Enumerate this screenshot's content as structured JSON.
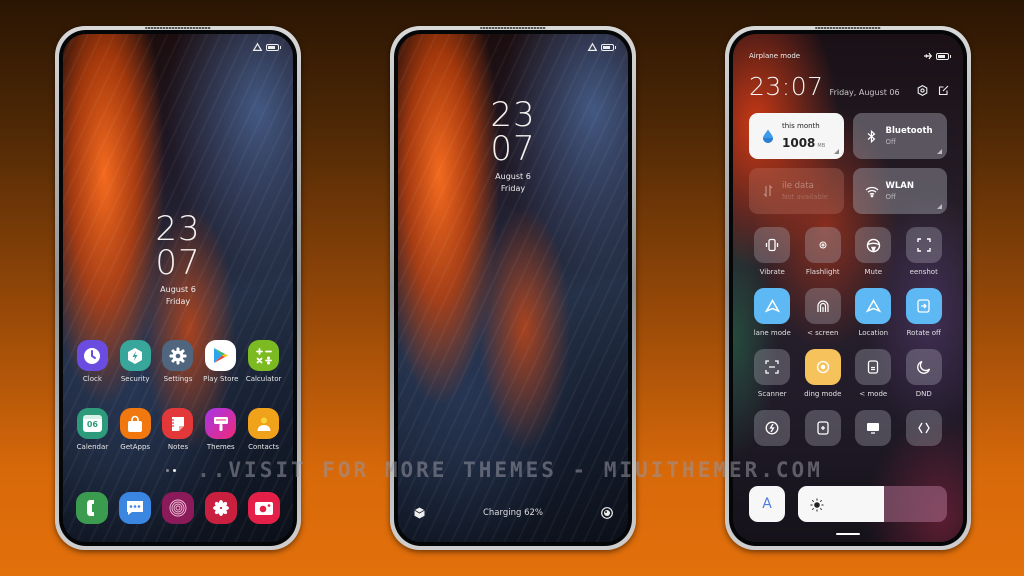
{
  "watermark": "..VISIT FOR MORE THEMES - MIUITHEMER.COM",
  "home_screen": {
    "clock": {
      "hours": "23",
      "minutes": "07",
      "date": "August 6",
      "day": "Friday"
    },
    "battery_percent": 60,
    "apps_row1": [
      {
        "label": "Clock",
        "icon": "clock-icon",
        "color": "#6a4de0"
      },
      {
        "label": "Security",
        "icon": "security-bolt-icon",
        "color": "#38a69a"
      },
      {
        "label": "Settings",
        "icon": "gear-icon",
        "color": "#50667e"
      },
      {
        "label": "Play Store",
        "icon": "play-store-icon",
        "color": "#ffffff"
      },
      {
        "label": "Calculator",
        "icon": "calculator-icon",
        "color": "#7cba22"
      }
    ],
    "apps_row2": [
      {
        "label": "Calendar",
        "icon": "calendar-icon",
        "color": "#2e9a7c",
        "glyph": "06"
      },
      {
        "label": "GetApps",
        "icon": "shopping-bag-icon",
        "color": "#f0780e"
      },
      {
        "label": "Notes",
        "icon": "notes-icon",
        "color": "#e2383a"
      },
      {
        "label": "Themes",
        "icon": "themes-brush-icon",
        "color": "#d8288a"
      },
      {
        "label": "Contacts",
        "icon": "contacts-icon",
        "color": "#f0a21a"
      }
    ],
    "dock": [
      {
        "name": "phone",
        "icon": "phone-icon",
        "color": "#3b9c4f"
      },
      {
        "name": "messages",
        "icon": "messages-icon",
        "color": "#3b86e0"
      },
      {
        "name": "fingerprint",
        "icon": "fingerprint-icon",
        "color": "#8a1a5a"
      },
      {
        "name": "gallery",
        "icon": "gallery-flower-icon",
        "color": "#c8203e"
      },
      {
        "name": "camera",
        "icon": "camera-icon",
        "color": "#e52048"
      }
    ]
  },
  "lock_screen": {
    "clock": {
      "hours": "23",
      "minutes": "07",
      "date": "August 6",
      "day": "Friday"
    },
    "charging_text": "Charging 62%",
    "battery_percent": 62
  },
  "control_center": {
    "status_label": "Airplane mode",
    "time": "23:07",
    "date": "Friday, August 06",
    "data_usage": {
      "label": "this month",
      "value": "1008",
      "unit": "MB"
    },
    "bluetooth": {
      "label": "Bluetooth",
      "state": "Off"
    },
    "mobile_data": {
      "label": "ile data",
      "state": "Not available"
    },
    "wlan": {
      "label": "WLAN",
      "state": "Off"
    },
    "toggles": [
      {
        "label": "Vibrate",
        "icon": "vibrate-icon",
        "active": false
      },
      {
        "label": "Flashlight",
        "icon": "flashlight-icon",
        "active": false
      },
      {
        "label": "Mute",
        "icon": "mute-icon",
        "active": false
      },
      {
        "label": "eenshot",
        "icon": "screenshot-icon",
        "active": false
      },
      {
        "label": "lane mode",
        "icon": "airplane-mode-icon",
        "active": true
      },
      {
        "label": "< screen",
        "icon": "lock-screen-icon",
        "active": false
      },
      {
        "label": "Location",
        "icon": "location-icon",
        "active": true
      },
      {
        "label": "Rotate off",
        "icon": "rotate-icon",
        "active": true
      },
      {
        "label": "Scanner",
        "icon": "scanner-icon",
        "active": false
      },
      {
        "label": "ding mode",
        "icon": "reading-mode-icon",
        "active": true
      },
      {
        "label": "< mode",
        "icon": "dark-mode-icon",
        "active": false
      },
      {
        "label": "DND",
        "icon": "dnd-moon-icon",
        "active": false
      },
      {
        "label": "",
        "icon": "battery-saver-icon",
        "active": false
      },
      {
        "label": "",
        "icon": "floating-window-icon",
        "active": false
      },
      {
        "label": "",
        "icon": "cast-icon",
        "active": false
      },
      {
        "label": "",
        "icon": "sync-icon",
        "active": false
      }
    ],
    "auto_brightness_label": "A",
    "brightness_percent": 58
  }
}
